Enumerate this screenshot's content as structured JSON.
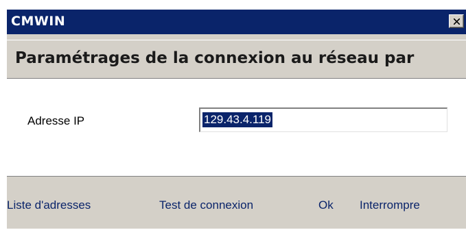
{
  "window": {
    "title": "CMWIN"
  },
  "header": {
    "title": "Paramétrages de la connexion au réseau par"
  },
  "form": {
    "ip_label": "Adresse IP",
    "ip_value": "129.43.4.119"
  },
  "footer": {
    "list_label": "Liste d'adresses",
    "test_label": "Test de connexion",
    "ok_label": "Ok",
    "cancel_label": "Interrompre"
  },
  "icons": {
    "close": "close-icon"
  },
  "colors": {
    "titlebar": "#0a246a",
    "face": "#d4d0c8",
    "link": "#0a246a",
    "selection": "#0a246a"
  }
}
